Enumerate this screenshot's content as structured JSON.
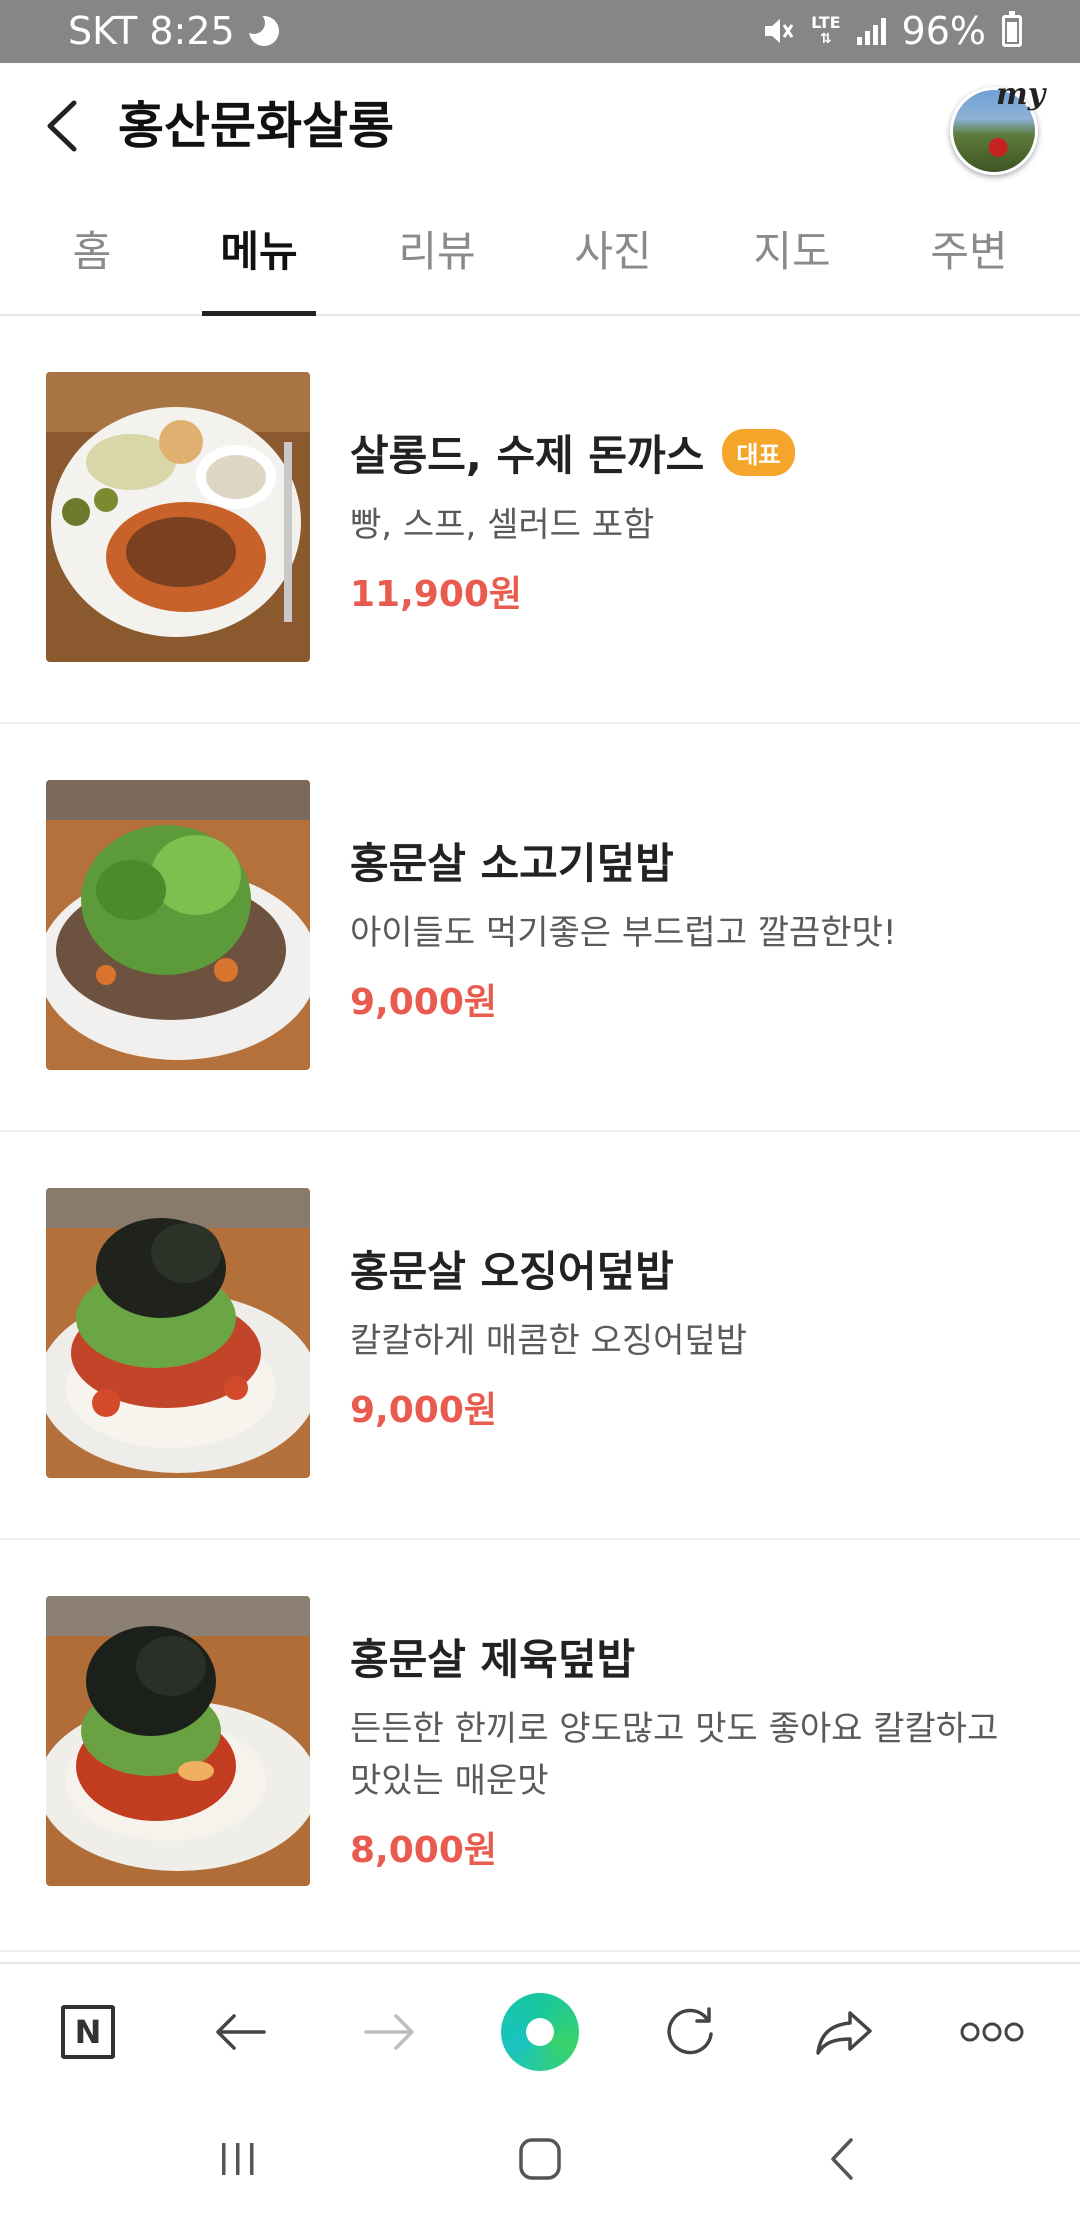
{
  "status": {
    "carrier_time": "SKT 8:25",
    "network": "LTE",
    "battery": "96%"
  },
  "header": {
    "title": "홍산문화살롱",
    "avatar_badge": "my"
  },
  "tabs": [
    {
      "label": "홈"
    },
    {
      "label": "메뉴"
    },
    {
      "label": "리뷰"
    },
    {
      "label": "사진"
    },
    {
      "label": "지도"
    },
    {
      "label": "주변"
    }
  ],
  "active_tab": "메뉴",
  "menu": [
    {
      "name": "살롱드, 수제 돈까스",
      "badge": "대표",
      "desc": "빵, 스프, 셀러드 포함",
      "price": "11,900원"
    },
    {
      "name": "홍문살 소고기덮밥",
      "desc": "아이들도 먹기좋은 부드럽고 깔끔한맛!",
      "price": "9,000원"
    },
    {
      "name": "홍문살 오징어덮밥",
      "desc": "칼칼하게 매콤한 오징어덮밥",
      "price": "9,000원"
    },
    {
      "name": "홍문살 제육덮밥",
      "desc": "든든한 한끼로 양도많고 맛도 좋아요 칼칼하고 맛있는 매운맛",
      "price": "8,000원"
    }
  ],
  "browser_toolbar": {
    "icons": [
      "naver-home-icon",
      "back-arrow-icon",
      "forward-arrow-icon",
      "green-dot-icon",
      "refresh-icon",
      "share-icon",
      "more-icon"
    ],
    "home_letter": "N"
  },
  "system_nav": {
    "icons": [
      "recent-apps-icon",
      "home-icon",
      "back-icon"
    ]
  },
  "colors": {
    "accent_price": "#e85b4e",
    "badge": "#f5a52a",
    "green_button": "#1ec88a",
    "statusbar": "#868686"
  }
}
